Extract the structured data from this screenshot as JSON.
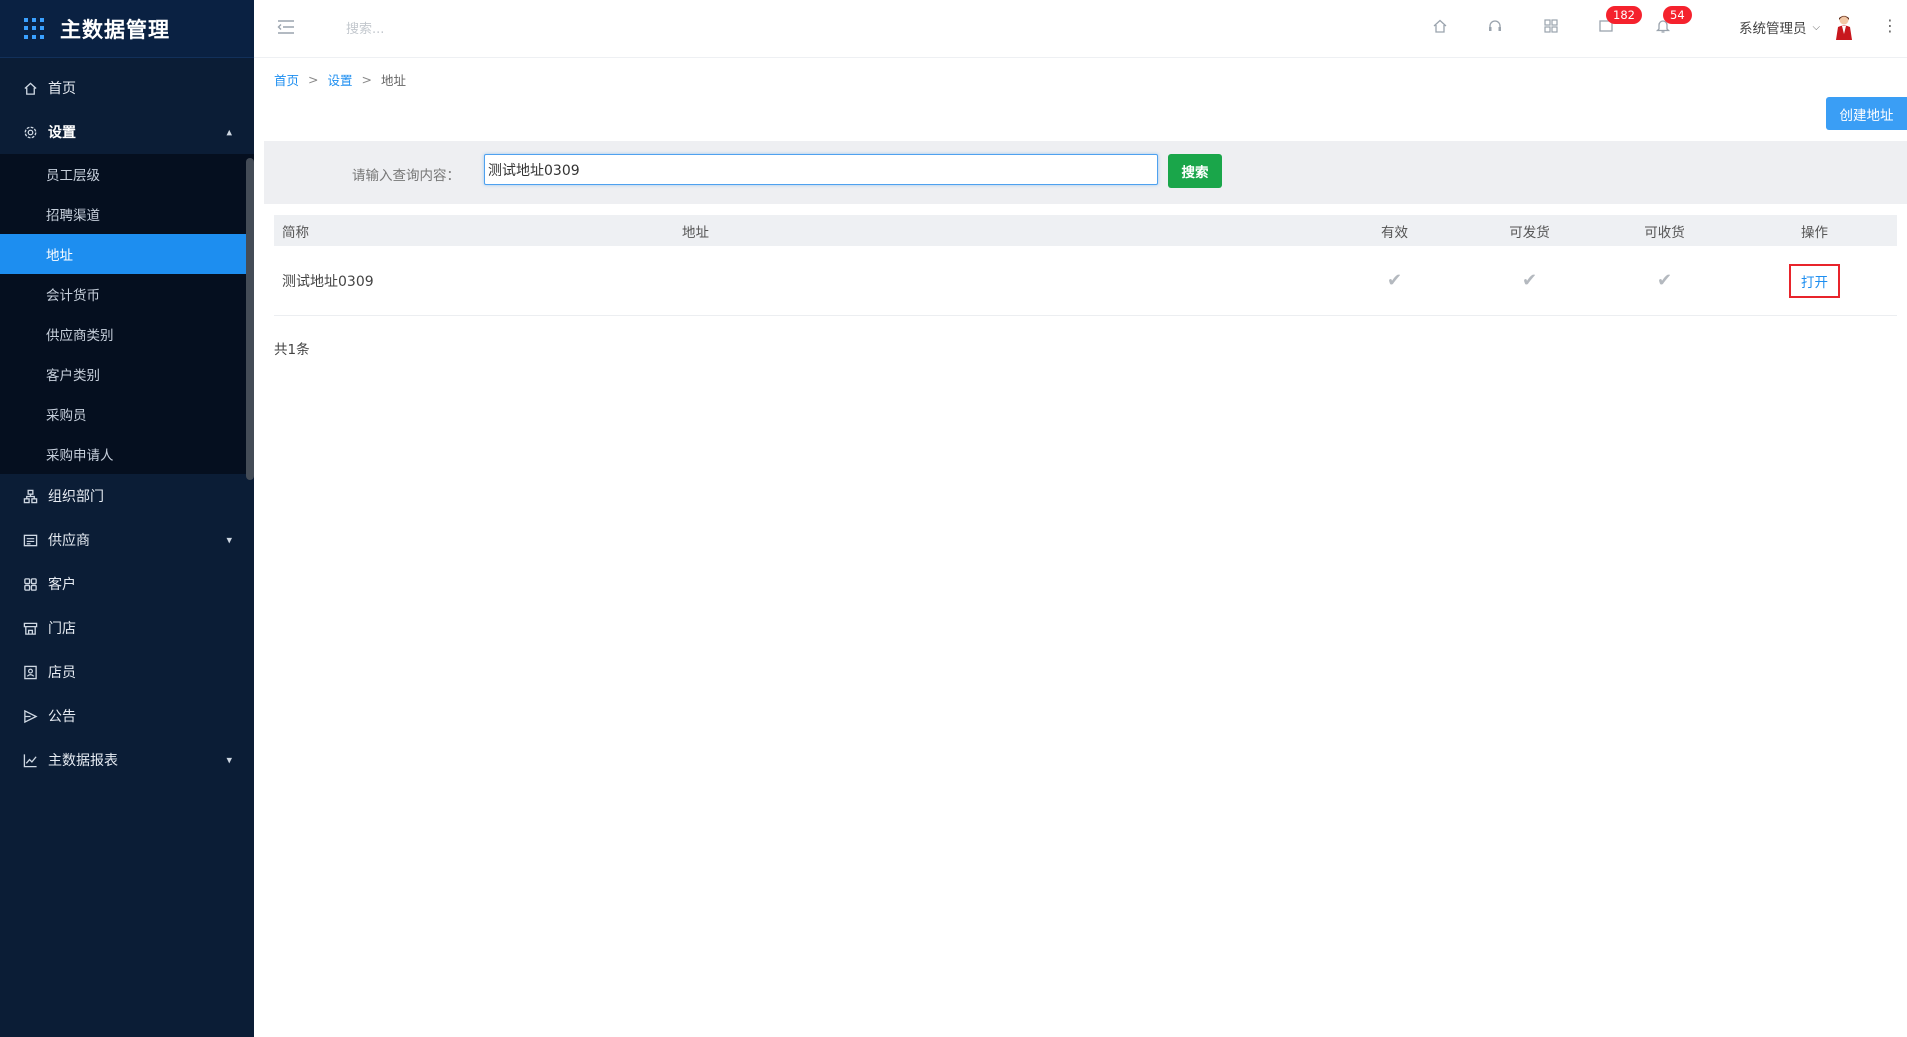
{
  "app": {
    "title": "主数据管理"
  },
  "sidebar": {
    "items": [
      {
        "label": "首页",
        "icon": "home-icon"
      },
      {
        "label": "设置",
        "icon": "gear-icon",
        "open": true,
        "children": [
          {
            "label": "员工层级"
          },
          {
            "label": "招聘渠道"
          },
          {
            "label": "地址",
            "active": true
          },
          {
            "label": "会计货币"
          },
          {
            "label": "供应商类别"
          },
          {
            "label": "客户类别"
          },
          {
            "label": "采购员"
          },
          {
            "label": "采购申请人"
          }
        ]
      },
      {
        "label": "组织部门",
        "icon": "org-icon"
      },
      {
        "label": "供应商",
        "icon": "supplier-icon",
        "expandable": true
      },
      {
        "label": "客户",
        "icon": "customer-icon"
      },
      {
        "label": "门店",
        "icon": "store-icon"
      },
      {
        "label": "店员",
        "icon": "clerk-icon"
      },
      {
        "label": "公告",
        "icon": "announcement-icon"
      },
      {
        "label": "主数据报表",
        "icon": "report-icon",
        "expandable": true
      }
    ]
  },
  "header": {
    "search_placeholder": "搜索...",
    "message_badge": "182",
    "notification_badge": "54",
    "user_name": "系统管理员"
  },
  "breadcrumb": {
    "home": "首页",
    "settings": "设置",
    "current": "地址",
    "separator": ">"
  },
  "toolbar": {
    "create_label": "创建地址"
  },
  "search": {
    "label": "请输入查询内容：",
    "value": "测试地址0309",
    "button_label": "搜索"
  },
  "table": {
    "headers": {
      "name": "简称",
      "address": "地址",
      "valid": "有效",
      "can_ship": "可发货",
      "can_receive": "可收货",
      "action": "操作"
    },
    "rows": [
      {
        "name": "测试地址0309",
        "address": "",
        "valid": true,
        "can_ship": true,
        "can_receive": true,
        "action_label": "打开"
      }
    ]
  },
  "footer": {
    "total": "共1条"
  },
  "colors": {
    "sidebar_bg": "#0b1d36",
    "accent": "#1d8ef0",
    "search_button": "#1aa64a",
    "badge": "#f5222d"
  }
}
